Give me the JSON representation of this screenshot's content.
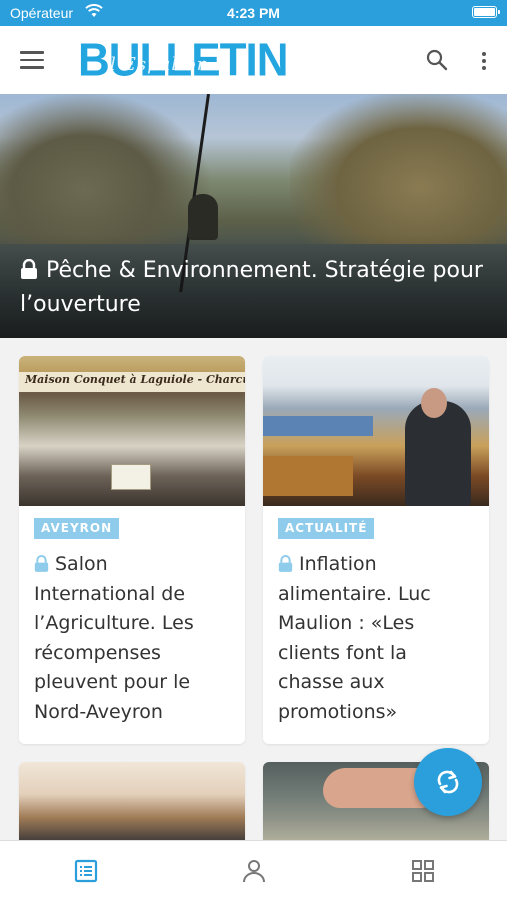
{
  "status_bar": {
    "carrier": "Opérateur",
    "time": "4:23 PM"
  },
  "app_bar": {
    "logo_text": "BULLETIN",
    "logo_script": "l'Espalion"
  },
  "hero": {
    "title": "Pêche & Environnement. Stratégie pour l’ouverture",
    "locked": true
  },
  "image_text": {
    "banner": "Maison Conquet à Laguiole - Charcuterie"
  },
  "cards": [
    {
      "tag": "AVEYRON",
      "title": "Salon International de l’Agriculture. Les récompenses pleuvent pour le Nord-Aveyron",
      "locked": true
    },
    {
      "tag": "ACTUALITÉ",
      "title": "Inflation alimentaire. Luc Maulion : «Les clients font la chasse aux promotions»",
      "locked": true
    }
  ],
  "tabs": [
    {
      "icon": "news-list-icon",
      "active": true
    },
    {
      "icon": "profile-icon",
      "active": false
    },
    {
      "icon": "grid-icon",
      "active": false
    }
  ],
  "colors": {
    "accent": "#2a9fdc",
    "tag_bg": "#8fcbea",
    "tab_active": "#2a9fdc",
    "tab_inactive": "#777777"
  }
}
